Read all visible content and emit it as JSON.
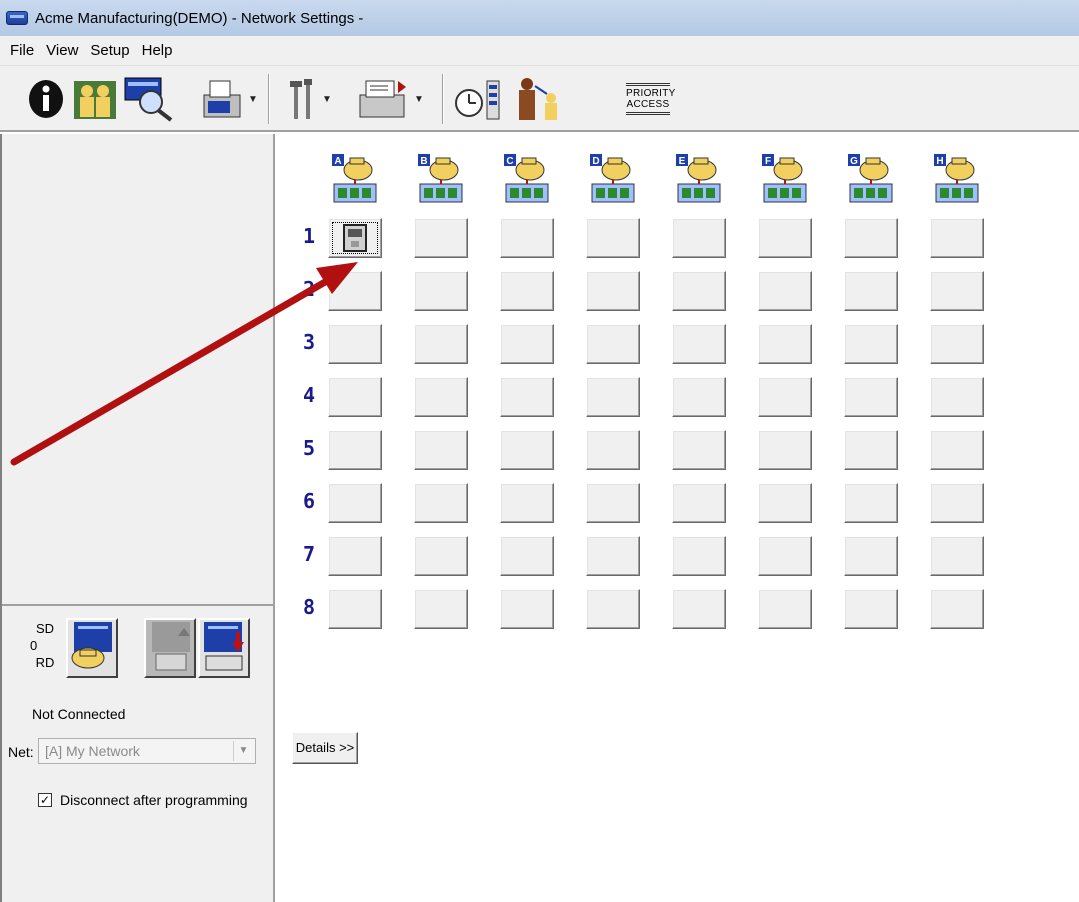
{
  "window": {
    "title": "Acme Manufacturing(DEMO) - Network Settings -"
  },
  "menu": [
    "File",
    "View",
    "Setup",
    "Help"
  ],
  "toolbar": {
    "items": [
      "info-icon",
      "users-icon",
      "monitor-search-icon",
      "fax-printer-icon",
      "tools-icon",
      "print-icon",
      "clock-schedule-icon",
      "person-transfer-icon"
    ],
    "priority_access": "PRIORITY\nACCESS"
  },
  "status": {
    "sd_label": "SD",
    "count": "0",
    "rd_label": "RD",
    "connection": "Not Connected",
    "net_label": "Net:",
    "net_value": "[A] My Network",
    "disconnect_label": "Disconnect after programming",
    "disconnect_checked": true
  },
  "grid": {
    "columns": [
      "A",
      "B",
      "C",
      "D",
      "E",
      "F",
      "G",
      "H"
    ],
    "rows": [
      "1",
      "2",
      "3",
      "4",
      "5",
      "6",
      "7",
      "8"
    ],
    "active_cell": {
      "row": "1",
      "column": "A"
    }
  },
  "details_button": "Details >>",
  "colors": {
    "annotation_arrow": "#b01010",
    "row_number": "#1a1a8a"
  }
}
